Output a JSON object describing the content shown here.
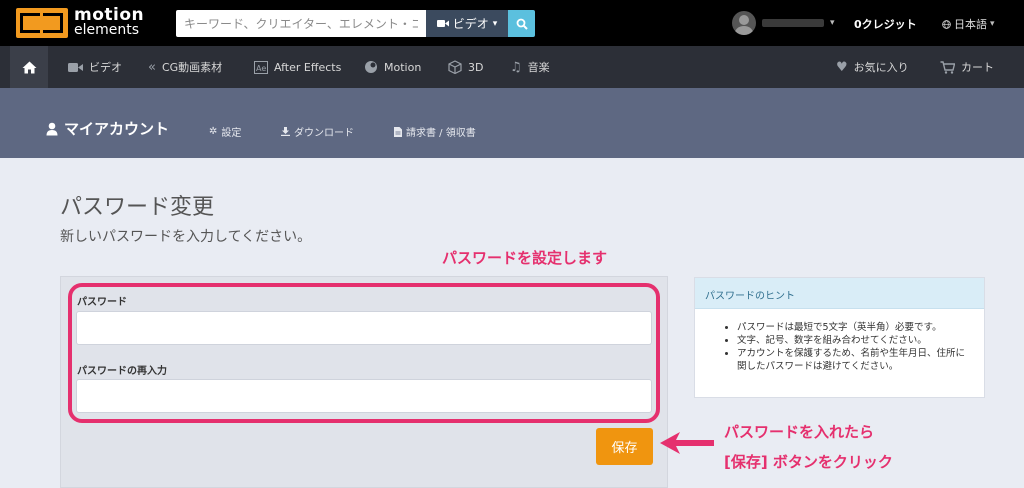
{
  "logo": {
    "line1": "motion",
    "line2": "elements"
  },
  "search": {
    "placeholder": "キーワード、クリエイター、エレメント・コ·",
    "type_label": "ビデオ"
  },
  "header": {
    "credits": "0クレジット",
    "language": "日本語"
  },
  "nav": {
    "items": [
      {
        "icon": "video-camera-icon",
        "label": "ビデオ"
      },
      {
        "icon": "cg-icon",
        "label": "CG動画素材"
      },
      {
        "icon": "after-effects-icon",
        "label": "After Effects"
      },
      {
        "icon": "motion-icon",
        "label": "Motion"
      },
      {
        "icon": "cube-icon",
        "label": "3D"
      },
      {
        "icon": "music-icon",
        "label": "音楽"
      }
    ],
    "favorites": "お気に入り",
    "cart": "カート"
  },
  "account": {
    "title": "マイアカウント",
    "settings": "設定",
    "downloads": "ダウンロード",
    "invoices": "請求書 / 領収書"
  },
  "main": {
    "title": "パスワード変更",
    "subtitle": "新しいパスワードを入力してください。",
    "password_label": "パスワード",
    "password_confirm_label": "パスワードの再入力",
    "save_label": "保存"
  },
  "hint": {
    "title": "パスワードのヒント",
    "items": [
      "パスワードは最短で5文字（英半角）必要です。",
      "文字、記号、数字を組み合わせてください。",
      "アカウントを保護するため、名前や生年月日、住所に関したパスワードは避けてください。"
    ]
  },
  "annotations": {
    "set_password": "パスワードを設定します",
    "enter_then_line1": "パスワードを入れたら",
    "enter_then_line2": "[保存] ボタンをクリック"
  },
  "colors": {
    "accent": "#f0950f",
    "annotation": "#e5306e",
    "search_button": "#5bc0de"
  }
}
